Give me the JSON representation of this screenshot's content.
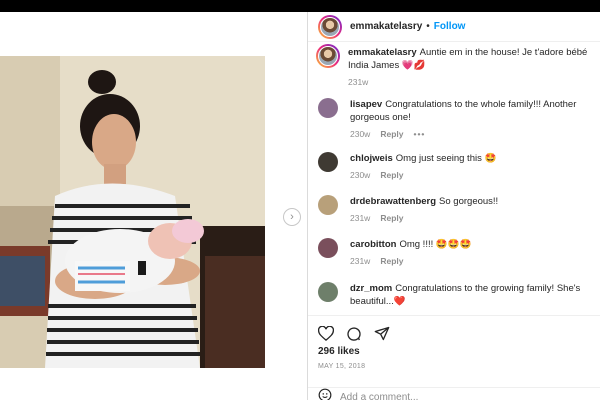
{
  "post": {
    "author": "emmakatelasry",
    "follow_label": "Follow",
    "separator": "•",
    "caption": {
      "username": "emmakatelasry",
      "text": "Auntie em in the house! Je t'adore bébé India James 💗💋",
      "time": "231w"
    },
    "comments": [
      {
        "username": "lisapev",
        "text": "Congratulations to the whole family!!! Another gorgeous one!",
        "time": "230w",
        "reply": "Reply",
        "more": "•••",
        "avatar_color": "#8a6e8f"
      },
      {
        "username": "chlojweis",
        "text": "Omg just seeing this 🤩",
        "time": "230w",
        "reply": "Reply",
        "avatar_color": "#3f3a33"
      },
      {
        "username": "drdebrawattenberg",
        "text": "So gorgeous!!",
        "time": "231w",
        "reply": "Reply",
        "avatar_color": "#b8a07a"
      },
      {
        "username": "carobitton",
        "text": "Omg !!!! 🤩🤩🤩",
        "time": "231w",
        "reply": "Reply",
        "avatar_color": "#7a4f5c"
      },
      {
        "username": "dzr_mom",
        "text": "Congratulations to the growing family! She's beautiful...❤️",
        "time": "",
        "reply": "",
        "avatar_color": "#6e7f6a"
      }
    ],
    "likes": "296 likes",
    "date": "MAY 15, 2018",
    "add_comment_placeholder": "Add a comment..."
  },
  "icons": {
    "heart": "heart-icon",
    "comment": "comment-icon",
    "share": "share-icon",
    "next": "chevron-right-icon",
    "emoji": "emoji-icon"
  },
  "colors": {
    "follow_blue": "#0095f6",
    "muted_text": "#8e8e8e",
    "border": "#efefef"
  }
}
